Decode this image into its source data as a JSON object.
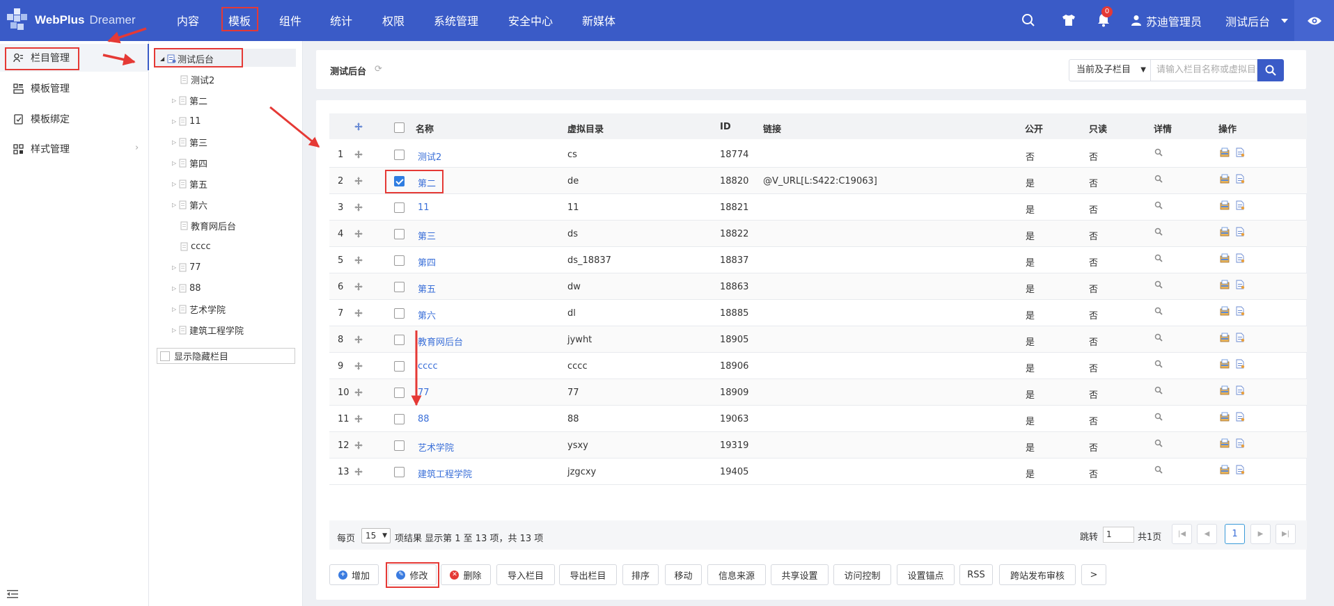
{
  "header": {
    "logo_text": "WebPlus",
    "logo_sub": "Dreamer",
    "nav": [
      "内容",
      "模板",
      "组件",
      "统计",
      "权限",
      "系统管理",
      "安全中心",
      "新媒体"
    ],
    "active_nav": "模板",
    "notification_count": "0",
    "user_name": "苏迪管理员",
    "site_name": "测试后台",
    "icons": [
      "search-icon",
      "shirt-icon",
      "bell-icon",
      "user-icon",
      "caret-down-icon",
      "eye-icon"
    ],
    "bg_color": "#3a5bc7"
  },
  "sidebar": {
    "items": [
      {
        "label": "栏目管理",
        "icon": "users-icon",
        "active": true
      },
      {
        "label": "模板管理",
        "icon": "template-icon"
      },
      {
        "label": "模板绑定",
        "icon": "bind-icon"
      },
      {
        "label": "样式管理",
        "icon": "grid-icon",
        "has_submenu": true
      }
    ]
  },
  "tree": {
    "root": "测试后台",
    "children": [
      {
        "label": "测试2",
        "expandable": false
      },
      {
        "label": "第二",
        "expandable": true
      },
      {
        "label": "11",
        "expandable": true
      },
      {
        "label": "第三",
        "expandable": true
      },
      {
        "label": "第四",
        "expandable": true
      },
      {
        "label": "第五",
        "expandable": true
      },
      {
        "label": "第六",
        "expandable": true
      },
      {
        "label": "教育网后台",
        "expandable": false
      },
      {
        "label": "cccc",
        "expandable": false
      },
      {
        "label": "77",
        "expandable": true
      },
      {
        "label": "88",
        "expandable": true
      },
      {
        "label": "艺术学院",
        "expandable": true
      },
      {
        "label": "建筑工程学院",
        "expandable": true
      }
    ],
    "show_hidden_label": "显示隐藏栏目"
  },
  "main": {
    "title": "测试后台",
    "scope_select": "当前及子栏目",
    "search_placeholder": "请输入栏目名称或虚拟目录",
    "table": {
      "columns": [
        "名称",
        "虚拟目录",
        "ID",
        "链接",
        "公开",
        "只读",
        "详情",
        "操作"
      ],
      "rows": [
        {
          "num": "1",
          "name": "测试2",
          "dir": "cs",
          "id": "18774",
          "link": "",
          "public": "否",
          "readonly": "否",
          "checked": false
        },
        {
          "num": "2",
          "name": "第二",
          "dir": "de",
          "id": "18820",
          "link": "@V_URL[L:S422:C19063]",
          "public": "是",
          "readonly": "否",
          "checked": true
        },
        {
          "num": "3",
          "name": "11",
          "dir": "11",
          "id": "18821",
          "link": "",
          "public": "是",
          "readonly": "否",
          "checked": false
        },
        {
          "num": "4",
          "name": "第三",
          "dir": "ds",
          "id": "18822",
          "link": "",
          "public": "是",
          "readonly": "否",
          "checked": false
        },
        {
          "num": "5",
          "name": "第四",
          "dir": "ds_18837",
          "id": "18837",
          "link": "",
          "public": "是",
          "readonly": "否",
          "checked": false
        },
        {
          "num": "6",
          "name": "第五",
          "dir": "dw",
          "id": "18863",
          "link": "",
          "public": "是",
          "readonly": "否",
          "checked": false
        },
        {
          "num": "7",
          "name": "第六",
          "dir": "dl",
          "id": "18885",
          "link": "",
          "public": "是",
          "readonly": "否",
          "checked": false
        },
        {
          "num": "8",
          "name": "教育网后台",
          "dir": "jywht",
          "id": "18905",
          "link": "",
          "public": "是",
          "readonly": "否",
          "checked": false
        },
        {
          "num": "9",
          "name": "cccc",
          "dir": "cccc",
          "id": "18906",
          "link": "",
          "public": "是",
          "readonly": "否",
          "checked": false
        },
        {
          "num": "10",
          "name": "77",
          "dir": "77",
          "id": "18909",
          "link": "",
          "public": "是",
          "readonly": "否",
          "checked": false
        },
        {
          "num": "11",
          "name": "88",
          "dir": "88",
          "id": "19063",
          "link": "",
          "public": "是",
          "readonly": "否",
          "checked": false
        },
        {
          "num": "12",
          "name": "艺术学院",
          "dir": "ysxy",
          "id": "19319",
          "link": "",
          "public": "是",
          "readonly": "否",
          "checked": false
        },
        {
          "num": "13",
          "name": "建筑工程学院",
          "dir": "jzgcxy",
          "id": "19405",
          "link": "",
          "public": "是",
          "readonly": "否",
          "checked": false
        }
      ]
    },
    "pagination": {
      "per_page_label": "每页",
      "per_page_value": "15",
      "summary": "项结果 显示第 1 至 13 项，共 13 项",
      "jump_label": "跳转",
      "jump_value": "1",
      "total_pages": "共1页",
      "current_page": "1"
    },
    "actions": [
      "增加",
      "修改",
      "删除",
      "导入栏目",
      "导出栏目",
      "排序",
      "移动",
      "信息来源",
      "共享设置",
      "访问控制",
      "设置锚点",
      "RSS",
      "跨站发布审核",
      ">"
    ]
  }
}
